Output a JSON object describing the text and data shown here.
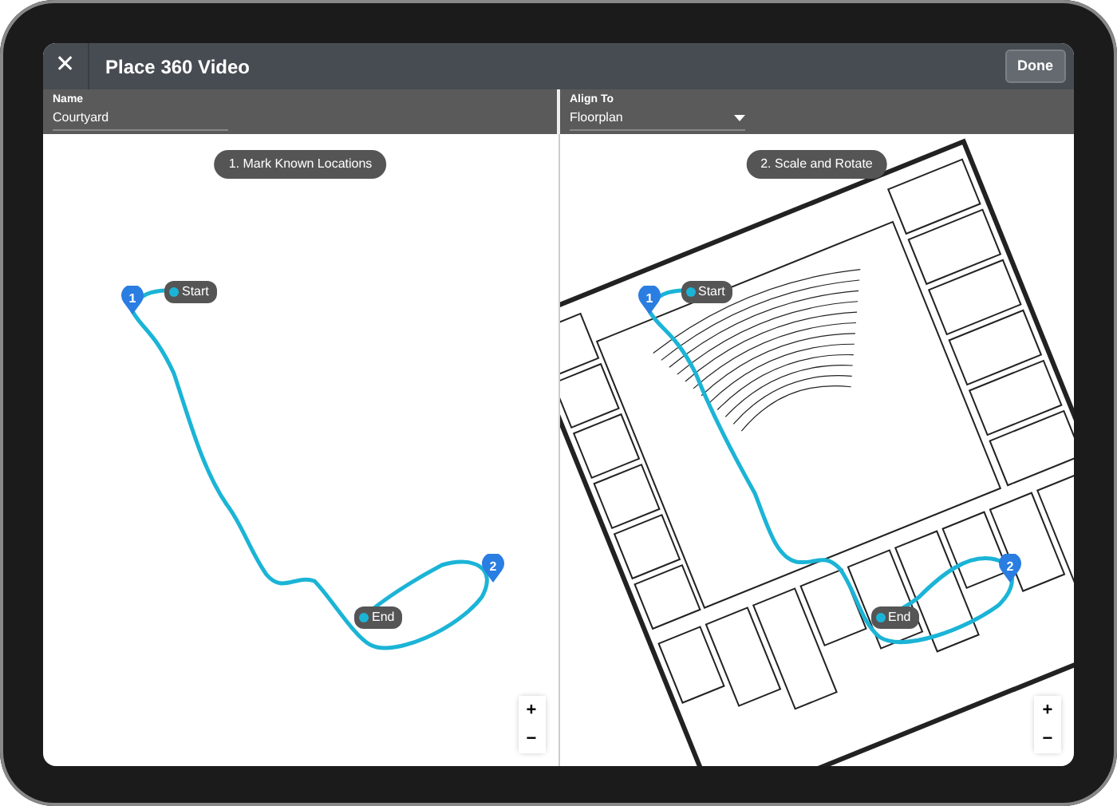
{
  "header": {
    "close": "✕",
    "title": "Place 360 Video",
    "done": "Done"
  },
  "fields": [
    {
      "label": "Name",
      "value": "Courtyard",
      "kind": "text"
    },
    {
      "label": "Align To",
      "value": "Floorplan",
      "kind": "select"
    }
  ],
  "panels": [
    {
      "step": "1. Mark Known Locations",
      "kind": "blank",
      "pins": [
        "1",
        "2"
      ],
      "start": "Start",
      "end": "End",
      "zoom": [
        "+",
        "−"
      ]
    },
    {
      "step": "2. Scale and Rotate",
      "kind": "floorplan",
      "pins": [
        "1",
        "2"
      ],
      "start": "Start",
      "end": "End",
      "zoom": [
        "+",
        "−"
      ]
    }
  ]
}
